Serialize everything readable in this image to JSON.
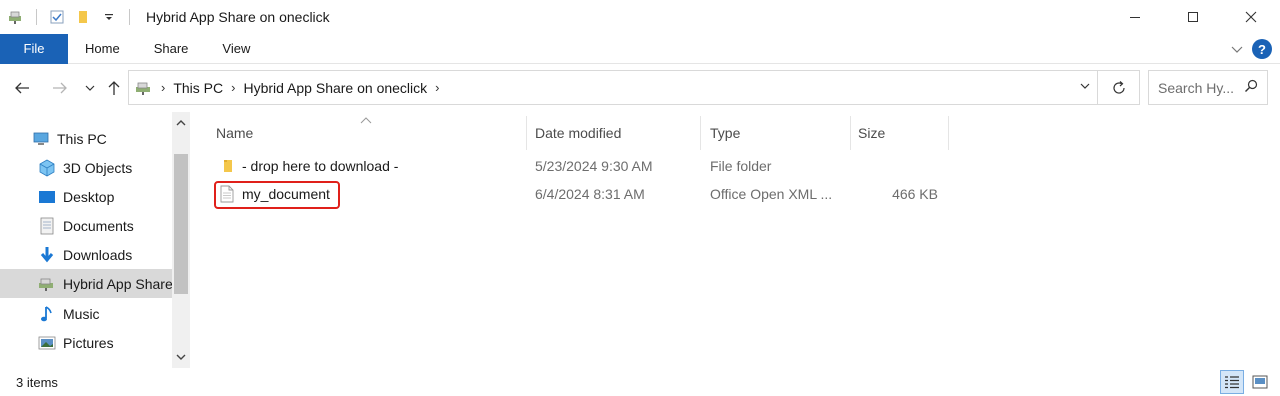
{
  "window": {
    "title": "Hybrid App Share on oneclick"
  },
  "ribbon": {
    "tabs": [
      "File",
      "Home",
      "Share",
      "View"
    ]
  },
  "address": {
    "crumbs": [
      "This PC",
      "Hybrid App Share on oneclick"
    ]
  },
  "search": {
    "placeholder": "Search Hy..."
  },
  "navpane": {
    "items": [
      {
        "label": "This PC",
        "icon": "computer-icon"
      },
      {
        "label": "3D Objects",
        "icon": "3d-objects-icon"
      },
      {
        "label": "Desktop",
        "icon": "desktop-icon"
      },
      {
        "label": "Documents",
        "icon": "documents-icon"
      },
      {
        "label": "Downloads",
        "icon": "downloads-icon"
      },
      {
        "label": "Hybrid App Share",
        "icon": "network-share-icon",
        "selected": true
      },
      {
        "label": "Music",
        "icon": "music-icon"
      },
      {
        "label": "Pictures",
        "icon": "pictures-icon"
      }
    ]
  },
  "filelist": {
    "columns": [
      "Name",
      "Date modified",
      "Type",
      "Size"
    ],
    "rows": [
      {
        "name": "- drop here to download -",
        "date": "5/23/2024 9:30 AM",
        "type": "File folder",
        "size": "",
        "icon": "folder-icon"
      },
      {
        "name": "my_document",
        "date": "6/4/2024 8:31 AM",
        "type": "Office Open XML ...",
        "size": "466 KB",
        "icon": "document-icon",
        "highlighted": true
      }
    ]
  },
  "status": {
    "item_count": "3 items"
  },
  "colors": {
    "accent": "#1a62b6",
    "highlight_border": "#e0201a",
    "folder": "#f4c74b"
  }
}
